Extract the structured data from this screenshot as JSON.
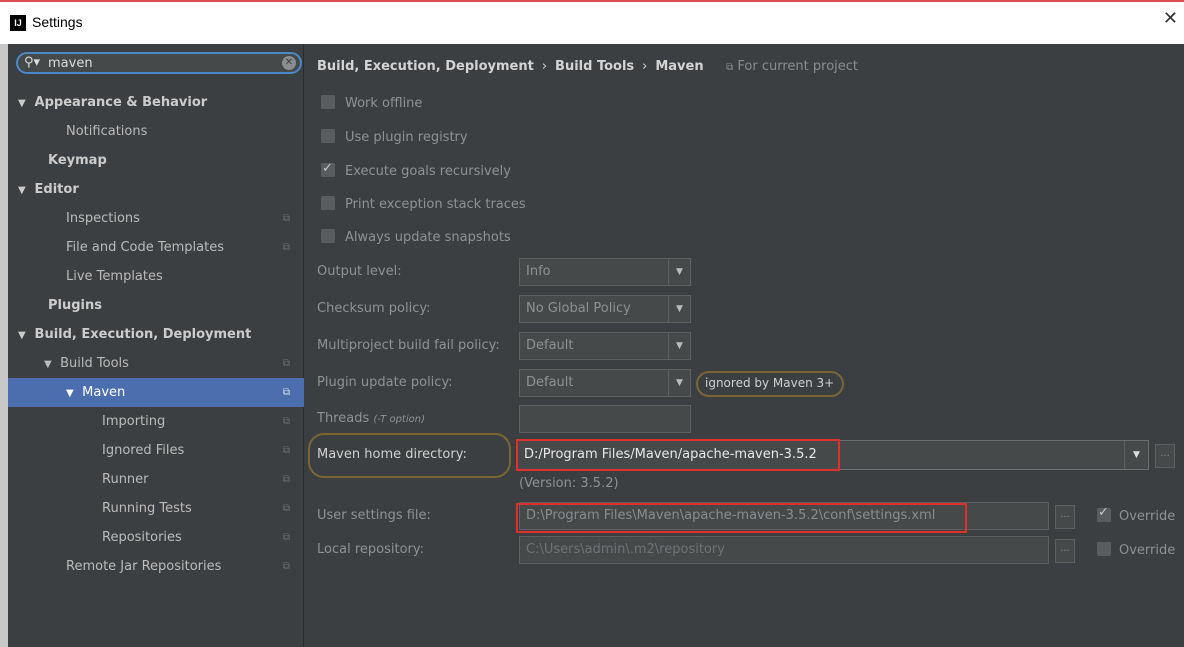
{
  "window": {
    "title": "Settings",
    "app_icon": "IJ",
    "close_glyph": "✕"
  },
  "search": {
    "value": "maven",
    "placeholder": ""
  },
  "tree": [
    {
      "label": "Appearance & Behavior",
      "arrow": "▼"
    },
    {
      "label": "Notifications"
    },
    {
      "label": "Keymap"
    },
    {
      "label": "Editor",
      "arrow": "▼"
    },
    {
      "label": "Inspections"
    },
    {
      "label": "File and Code Templates"
    },
    {
      "label": "Live Templates"
    },
    {
      "label": "Plugins"
    },
    {
      "label": "Build, Execution, Deployment",
      "arrow": "▼"
    },
    {
      "label": "Build Tools",
      "arrow": "▼"
    },
    {
      "label": "Maven",
      "arrow": "▼"
    },
    {
      "label": "Importing"
    },
    {
      "label": "Ignored Files"
    },
    {
      "label": "Runner"
    },
    {
      "label": "Running Tests"
    },
    {
      "label": "Repositories"
    },
    {
      "label": "Remote Jar Repositories"
    }
  ],
  "breadcrumb": {
    "part1": "Build, Execution, Deployment",
    "part2": "Build Tools",
    "part3": "Maven",
    "separator": "›",
    "project_note": "For current project"
  },
  "checkboxes": {
    "work_offline": "Work offline",
    "plugin_registry": "Use plugin registry",
    "goals_recursive": "Execute goals recursively",
    "exception_traces": "Print exception stack traces",
    "update_snapshots": "Always update snapshots"
  },
  "labels": {
    "output_level": "Output level:",
    "checksum_policy": "Checksum policy:",
    "multiproject": "Multiproject build fail policy:",
    "plugin_update": "Plugin update policy:",
    "threads": "Threads",
    "threads_hint": "(-T option)",
    "maven_home": "Maven home directory:",
    "user_settings": "User settings file:",
    "local_repo": "Local repository:"
  },
  "values": {
    "output_level": "Info",
    "checksum_policy": "No Global Policy",
    "multiproject": "Default",
    "plugin_update": "Default",
    "plugin_update_note": "ignored by Maven 3+",
    "threads": "",
    "maven_home": "D:/Program Files/Maven/apache-maven-3.5.2",
    "version": "(Version: 3.5.2)",
    "user_settings": "D:\\Program Files\\Maven\\apache-maven-3.5.2\\conf\\settings.xml",
    "local_repo": "C:\\Users\\admin\\.m2\\repository",
    "override": "Override",
    "browse": "..."
  }
}
